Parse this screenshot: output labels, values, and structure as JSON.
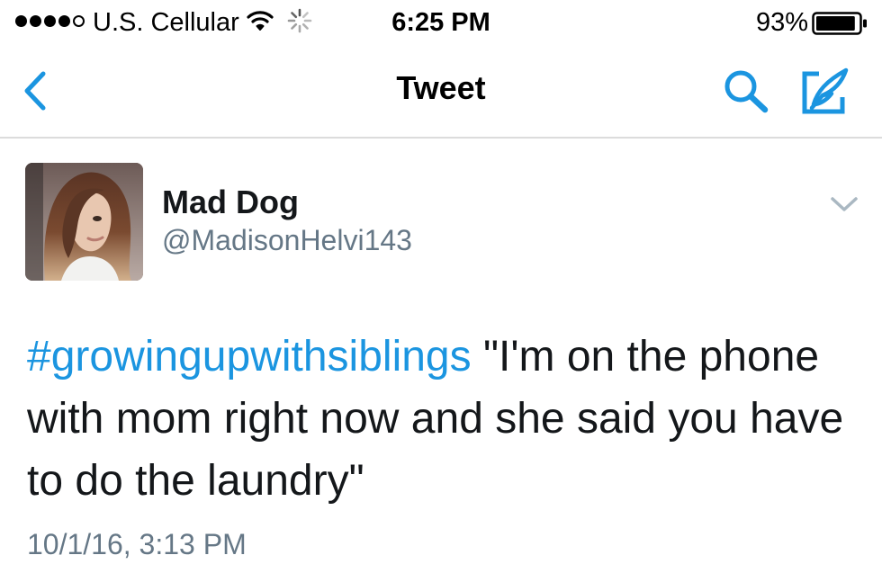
{
  "status_bar": {
    "signal_dots": [
      "full",
      "full",
      "full",
      "full",
      "empty"
    ],
    "carrier": "U.S. Cellular",
    "wifi_icon": "wifi-icon",
    "activity_icon": "activity-spinner-icon",
    "time": "6:25 PM",
    "battery_percent": "93%",
    "battery_level": 0.93
  },
  "nav": {
    "back_icon": "chevron-left-icon",
    "title": "Tweet",
    "search_icon": "search-icon",
    "compose_icon": "compose-icon"
  },
  "tweet": {
    "author_name": "Mad Dog",
    "author_handle": "@MadisonHelvi143",
    "menu_icon": "chevron-down-icon",
    "hashtag": "#growingupwithsiblings",
    "body": " \"I'm on the phone with mom right now and she said you have to do the laundry\"",
    "timestamp": "10/1/16, 3:13 PM"
  },
  "colors": {
    "accent": "#1b95e0",
    "text_primary": "#14171a",
    "text_secondary": "#657786",
    "divider": "#dcdcdc"
  }
}
